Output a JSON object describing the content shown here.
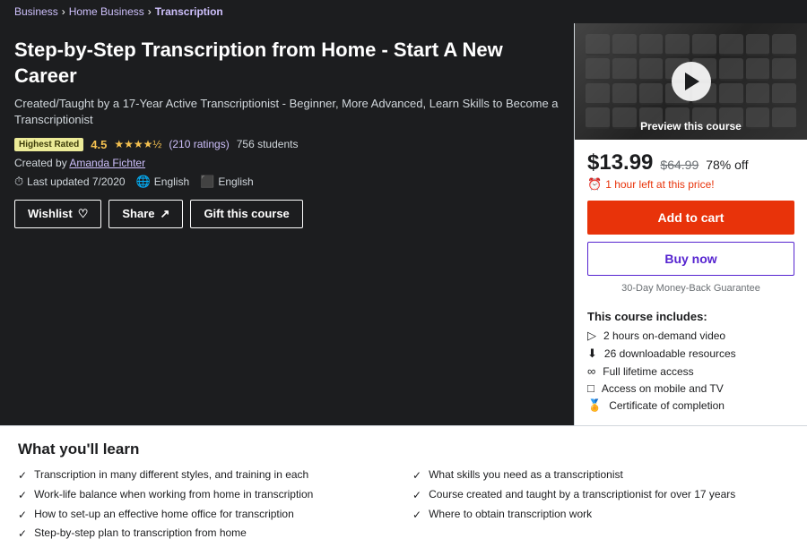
{
  "breadcrumb": {
    "items": [
      "Business",
      "Home Business",
      "Transcription"
    ],
    "separators": [
      ">",
      ">"
    ]
  },
  "course": {
    "title": "Step-by-Step Transcription from Home - Start A New Career",
    "subtitle": "Created/Taught by a 17-Year Active Transcriptionist - Beginner, More Advanced, Learn Skills to Become a Transcriptionist",
    "badge": "Highest Rated",
    "rating": "4.5",
    "stars": "★★★★½",
    "rating_count": "(210 ratings)",
    "students": "756 students",
    "created_by_label": "Created by",
    "instructor": "Amanda Fichter",
    "last_updated_label": "Last updated 7/2020",
    "language1": "English",
    "language2": "English",
    "buttons": {
      "wishlist": "Wishlist",
      "share": "Share",
      "gift": "Gift this course"
    }
  },
  "preview": {
    "label": "Preview this course"
  },
  "pricing": {
    "current": "$13.99",
    "original": "$64.99",
    "discount": "78% off",
    "timer": "1 hour left at this price!",
    "add_to_cart": "Add to cart",
    "buy_now": "Buy now",
    "guarantee": "30-Day Money-Back Guarantee"
  },
  "includes": {
    "title": "This course includes:",
    "items": [
      {
        "icon": "▷",
        "text": "2 hours on-demand video"
      },
      {
        "icon": "⬇",
        "text": "26 downloadable resources"
      },
      {
        "icon": "∞",
        "text": "Full lifetime access"
      },
      {
        "icon": "□",
        "text": "Access on mobile and TV"
      },
      {
        "icon": "🏅",
        "text": "Certificate of completion"
      }
    ]
  },
  "learn": {
    "title": "What you'll learn",
    "items": [
      "Transcription in many different styles, and training in each",
      "What skills you need as a transcriptionist",
      "Work-life balance when working from home in transcription",
      "Course created and taught by a transcriptionist for over 17 years",
      "How to set-up an effective home office for transcription",
      "Where to obtain transcription work",
      "Step-by-step plan to transcription from home"
    ]
  }
}
